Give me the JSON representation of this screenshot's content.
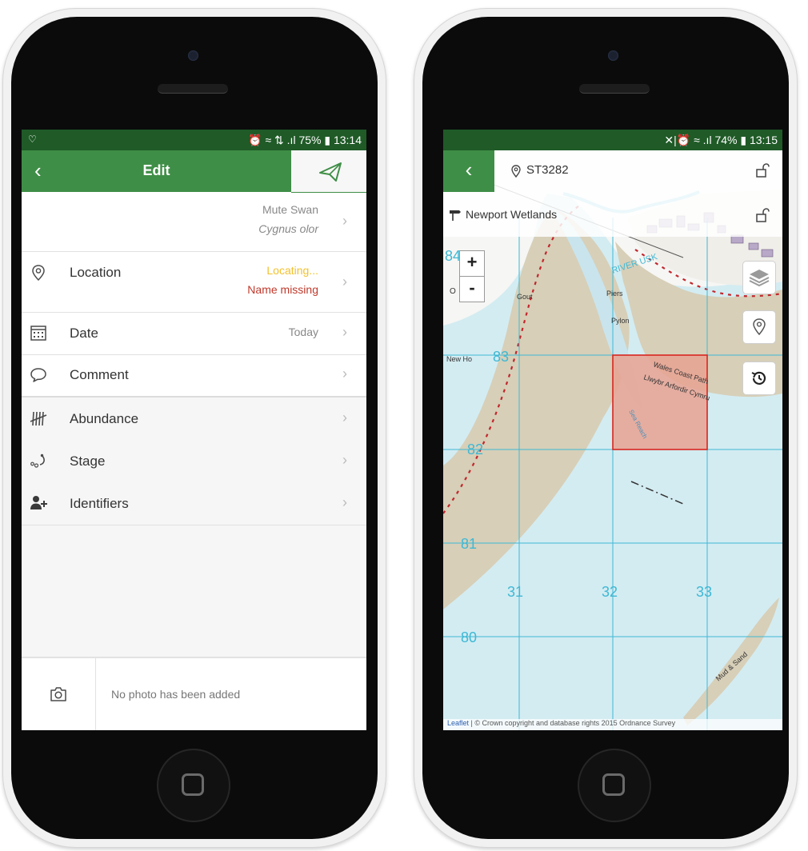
{
  "left_phone": {
    "status": {
      "left": "♡",
      "right": "⏰ ≈ ⇅ .ıl 75% ▮ 13:14"
    },
    "appbar": {
      "title": "Edit",
      "back_icon": "chevron-left-icon",
      "save_icon": "paper-plane-icon"
    },
    "species": {
      "common": "Mute Swan",
      "latin": "Cygnus olor"
    },
    "rows": {
      "location": {
        "label": "Location",
        "status1": "Locating...",
        "status2": "Name missing",
        "icon": "location-pin-icon"
      },
      "date": {
        "label": "Date",
        "value": "Today",
        "icon": "calendar-icon"
      },
      "comment": {
        "label": "Comment",
        "icon": "comment-icon"
      },
      "abundance": {
        "label": "Abundance",
        "icon": "tally-icon"
      },
      "stage": {
        "label": "Stage",
        "icon": "stage-icon"
      },
      "identifiers": {
        "label": "Identifiers",
        "icon": "add-user-icon"
      }
    },
    "chevron": "›",
    "photo": {
      "text": "No photo has been added",
      "icon": "camera-icon"
    },
    "colors": {
      "primary": "#3f8e47",
      "status_bar": "#1f5a27",
      "locating": "#f2c12e",
      "missing": "#c0392b"
    }
  },
  "right_phone": {
    "status": {
      "right": "✕|⏰ ≈ .ıl 74% ▮ 13:15"
    },
    "header": {
      "gridref": "ST3282",
      "place": "Newport Wetlands",
      "back_icon": "chevron-left-icon",
      "lock_icon": "unlock-icon",
      "pin_icon": "location-pin-icon",
      "flag_icon": "signpost-icon"
    },
    "zoom": {
      "in": "+",
      "out": "-"
    },
    "map_buttons": [
      "layers-icon",
      "location-pin-icon",
      "history-icon"
    ],
    "map_labels": {
      "grid_83": "83",
      "grid_82": "82",
      "grid_81": "81",
      "grid_80": "80",
      "grid_84": "84",
      "grid_31": "31",
      "grid_32": "32",
      "grid_33": "33",
      "river": "RIVER USK",
      "piers": "Piers",
      "pylon": "Pylon",
      "gout": "Gout",
      "new_ho": "New Ho",
      "wales_coast": "Wales Coast Path",
      "llwybr": "Llwybr Arfordir Cymru",
      "sea_reach": "Sea Reach",
      "mud_sand": "Mud & Sand",
      "o_label": "O"
    },
    "attribution": {
      "leaflet": "Leaflet",
      "rest": " | © Crown copyright and database rights 2015 Ordnance Survey"
    },
    "colors": {
      "sea": "#d3ecf2",
      "land": "#f6f6f4",
      "mud": "#d7cfb8",
      "grid": "#3fb8d4",
      "square_fill": "#e8a292",
      "square_stroke": "#d8261f"
    }
  }
}
